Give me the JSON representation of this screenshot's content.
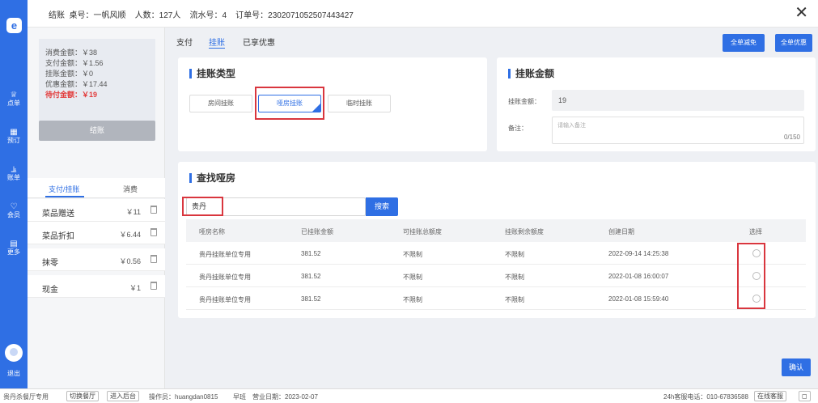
{
  "sidebar": {
    "logo": "e",
    "items": [
      {
        "icon": "♕",
        "label": "点单"
      },
      {
        "icon": "▦",
        "label": "预订"
      },
      {
        "icon": "⫡",
        "label": "账单"
      },
      {
        "icon": "♡",
        "label": "会员"
      },
      {
        "icon": "▤",
        "label": "更多"
      }
    ],
    "exit": "退出"
  },
  "topbar": {
    "info": "结账  桌号：一帆风顺    人数：127人    流水号：4    订单号：2302071052507443427",
    "close": "✕"
  },
  "summary": {
    "consume": "消费金额：￥38",
    "paid": "支付金额：￥1.56",
    "credit": "挂账金额：￥0",
    "discount": "优惠金额：￥17.44",
    "due": "待付金额：￥19",
    "settle_button": "结账"
  },
  "left_tabs": {
    "pay": "支付/挂账",
    "consume": "消费"
  },
  "payments": [
    {
      "name": "菜品赠送",
      "amount": "￥11"
    },
    {
      "name": "菜品折扣",
      "amount": "￥6.44"
    },
    {
      "name": "抹零",
      "amount": "￥0.56"
    },
    {
      "name": "现金",
      "amount": "￥1"
    }
  ],
  "main_tabs": {
    "pay": "支付",
    "credit": "挂账",
    "discount": "已享优惠"
  },
  "actions": {
    "full_exempt": "全单减免",
    "full_discount": "全单优惠",
    "confirm": "确认"
  },
  "credit_type": {
    "title": "挂账类型",
    "options": [
      "房间挂账",
      "哑房挂账",
      "临时挂账"
    ],
    "selected": "哑房挂账"
  },
  "credit_amount": {
    "title": "挂账金额",
    "amount_label": "挂账金额：",
    "amount_value": "19",
    "note_label": "备注：",
    "note_placeholder": "请输入备注",
    "note_count": "0/150"
  },
  "search": {
    "title": "查找哑房",
    "value": "贵丹",
    "button": "搜索"
  },
  "table": {
    "headers": [
      "哑房名称",
      "已挂账金额",
      "可挂账总额度",
      "挂账剩余额度",
      "创建日期",
      "选择"
    ],
    "rows": [
      [
        "贵丹挂账单位专用",
        "381.52",
        "不限制",
        "不限制",
        "2022-09-14 14:25:38"
      ],
      [
        "贵丹挂账单位专用",
        "381.52",
        "不限制",
        "不限制",
        "2022-01-08 16:00:07"
      ],
      [
        "贵丹挂账单位专用",
        "381.52",
        "不限制",
        "不限制",
        "2022-01-08 15:59:40"
      ]
    ]
  },
  "footer": {
    "shop": "贵丹杀餐厅专用",
    "switch_shop": "切换餐厅",
    "enter_backend": "进入后台",
    "operator": "操作员：huangdan0815",
    "shift": "早班",
    "business_date": "营业日期：2023-02-07",
    "hotline": "24h客服电话：010-67836588",
    "online_service": "在线客服",
    "fullscreen": "◻"
  },
  "colors": {
    "primary": "#2f6fe4",
    "highlight": "#d9363e",
    "due": "#e23c3c"
  }
}
